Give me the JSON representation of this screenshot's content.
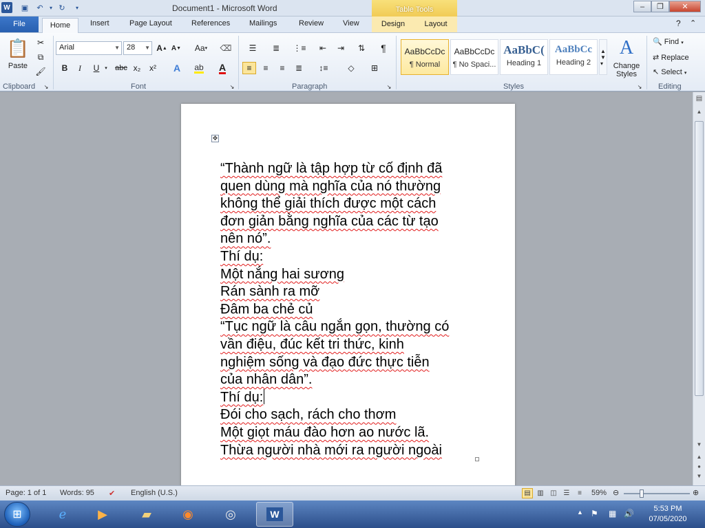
{
  "window": {
    "title": "Document1  -  Microsoft Word",
    "context_tab_group": "Table Tools"
  },
  "tabs": {
    "file": "File",
    "items": [
      "Home",
      "Insert",
      "Page Layout",
      "References",
      "Mailings",
      "Review",
      "View"
    ],
    "context": [
      "Design",
      "Layout"
    ]
  },
  "ribbon": {
    "clipboard": {
      "paste": "Paste",
      "label": "Clipboard"
    },
    "font": {
      "name": "Arial",
      "size": "28",
      "label": "Font",
      "grow": "A",
      "shrink": "A",
      "case": "Aa",
      "bold": "B",
      "italic": "I",
      "underline": "U",
      "strike": "abc",
      "sub": "x₂",
      "sup": "x²"
    },
    "paragraph": {
      "label": "Paragraph",
      "pilcrow": "¶"
    },
    "styles": {
      "label": "Styles",
      "tiles": [
        {
          "sample": "AaBbCcDc",
          "name": "¶ Normal"
        },
        {
          "sample": "AaBbCcDc",
          "name": "¶ No Spaci..."
        },
        {
          "sample": "AaBbC(",
          "name": "Heading 1"
        },
        {
          "sample": "AaBbCc",
          "name": "Heading 2"
        }
      ],
      "change_styles": "Change Styles"
    },
    "editing": {
      "label": "Editing",
      "find": "Find",
      "replace": "Replace",
      "select": "Select"
    }
  },
  "document": {
    "lines": [
      "“Thành ngữ là tập hợp từ cố định đã",
      "quen dùng mà nghĩa của nó thường",
      "không thể giải thích được một cách",
      "đơn giản bằng nghĩa của các từ tạo",
      "nên nó”.",
      "Thí dụ:",
      "Một nắng hai sương",
      "Rán sành ra mỡ",
      "Đâm ba chẻ củ",
      "“Tục ngữ là câu ngắn gọn, thường có",
      "vần điệu, đúc kết tri thức, kinh",
      "nghiệm sống và đạo đức thực tiễn",
      "của nhân dân”.",
      "Thí dụ:",
      "Đói cho sạch, rách cho thơm",
      "Một giọt máu đào hơn ao nước lã.",
      "Thừa người nhà mới ra người ngoài"
    ],
    "caret_line": 13
  },
  "status": {
    "page": "Page: 1 of 1",
    "words": "Words: 95",
    "language": "English (U.S.)",
    "zoom": "59%",
    "zoom_value": 59
  },
  "taskbar": {
    "time": "5:53 PM",
    "date": "07/05/2020"
  },
  "colors": {
    "accent": "#2b579a",
    "file_tab": "#2b5fad",
    "context_tab": "#f0c850",
    "spell_squiggle": "#e21b1b"
  }
}
